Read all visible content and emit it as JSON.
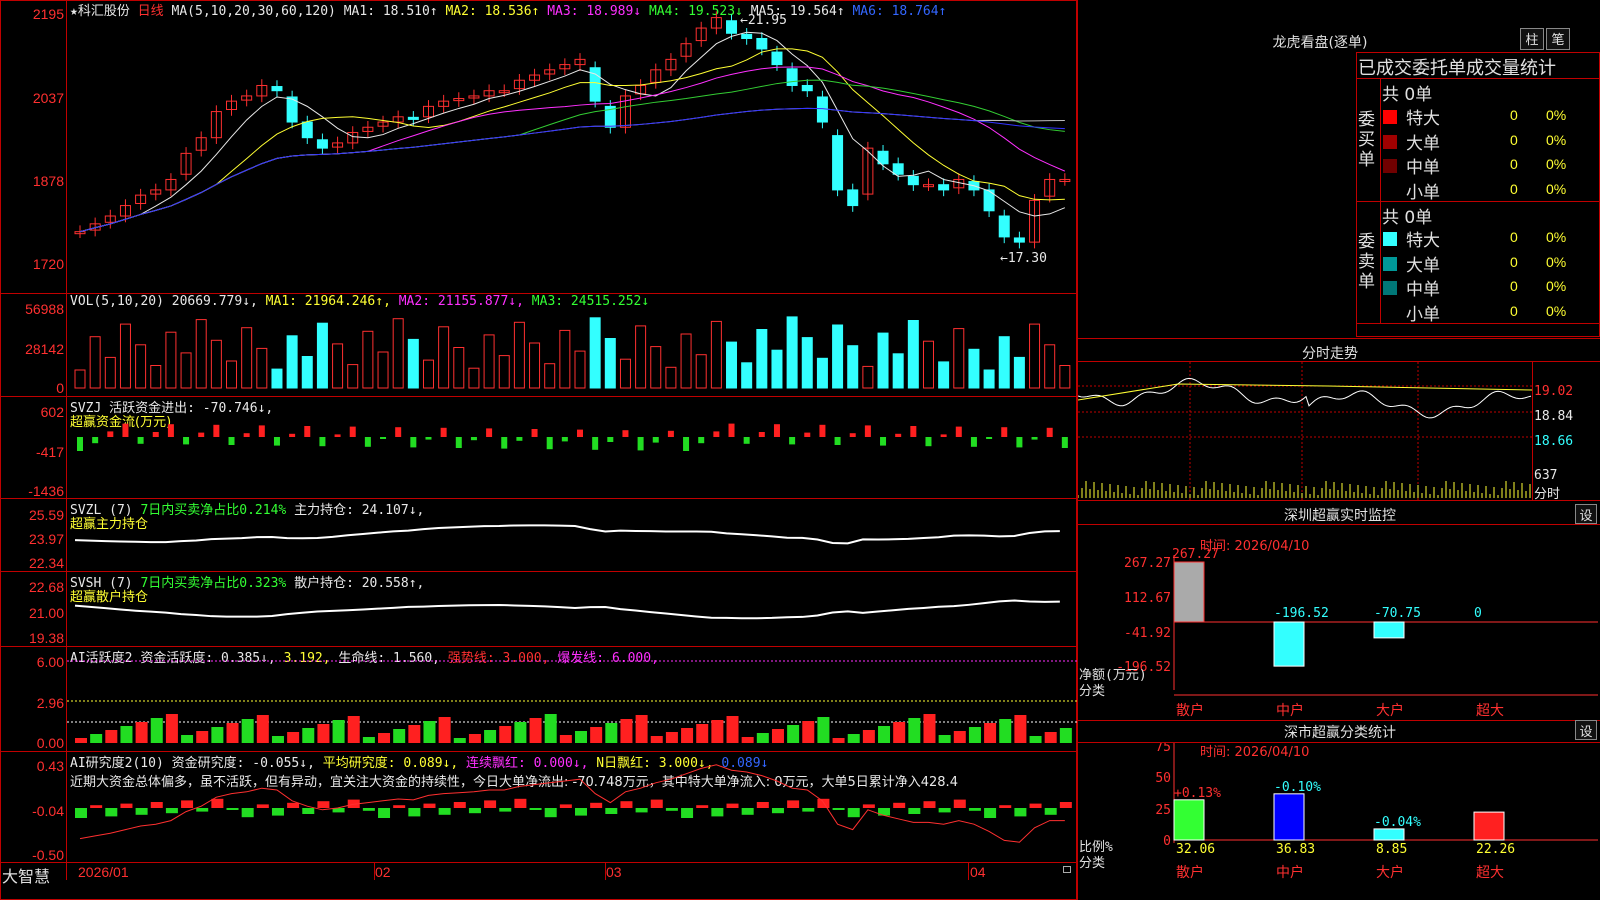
{
  "stock": {
    "star": "★",
    "name": "科汇股份",
    "period": "日线",
    "ma_label": "MA(5,10,20,30,60,120)",
    "ma": [
      {
        "l": "MA1: 18.510↑",
        "c": "w"
      },
      {
        "l": "MA2: 18.536↑",
        "c": "y"
      },
      {
        "l": "MA3: 18.989↓",
        "c": "m"
      },
      {
        "l": "MA4: 19.523↓",
        "c": "g"
      },
      {
        "l": "MA5: 19.564↑",
        "c": "w"
      },
      {
        "l": "MA6: 18.764↑",
        "c": "b"
      }
    ],
    "high_mark": "21.95",
    "low_mark": "17.30",
    "y_labels": [
      "2195",
      "2037",
      "1878",
      "1720"
    ]
  },
  "vol": {
    "header": "VOL(5,10,20)",
    "v": "20669.779↓,",
    "ma1": "MA1: 21964.246↑,",
    "ma2": "MA2: 21155.877↓,",
    "ma3": "MA3: 24515.252↓",
    "y_labels": [
      "56988",
      "28142",
      "0"
    ]
  },
  "svzj": {
    "header": "SVZJ  活跃资金进出: -70.746↓,",
    "sub": "超赢资金流(万元)",
    "y_labels": [
      "602",
      "-417",
      "-1436"
    ]
  },
  "svzl": {
    "header1": "SVZL (7)",
    "header2": "7日内买卖净占比0.214%",
    "header3": "主力持仓: 24.107↓,",
    "sub": "超赢主力持仓",
    "y_labels": [
      "25.59",
      "23.97",
      "22.34"
    ]
  },
  "svsh": {
    "header1": "SVSH (7)",
    "header2": "7日内买卖净占比0.323%",
    "header3": "散户持仓: 20.558↑,",
    "sub": "超赢散户持仓",
    "y_labels": [
      "22.68",
      "21.00",
      "19.38"
    ]
  },
  "ai": {
    "h1": "AI活跃度2",
    "h2": "资金活跃度: 0.385↓,",
    "h3": "3.192,",
    "h4": "生命线: 1.560,",
    "h5": "强势线: 3.000,",
    "h6": "爆发线: 6.000,",
    "y_labels": [
      "6.00",
      "2.96",
      "0.00"
    ]
  },
  "research": {
    "h1": "AI研究度2(10)",
    "h2": "资金研究度: -0.055↓,",
    "h3": "平均研究度: 0.089↓,",
    "h4": "连续飘红: 0.000↓,",
    "h5": "N日飘红: 3.000↓,",
    "h6": "0.089↓",
    "text": "近期大资金总体偏多，虽不活跃，但有异动，宜关注大资金的持续性，今日大单净流出: -70.748万元，其中特大单净流入: 0万元，大单5日累计净入428.4",
    "y_labels": [
      "0.43",
      "-0.04",
      "-0.50"
    ]
  },
  "footer": {
    "brand": "大智慧",
    "dates": [
      "2026/01",
      "02",
      "03",
      "04"
    ]
  },
  "lhb": {
    "title": "龙虎看盘(逐单)",
    "btn1": "柱",
    "btn2": "笔",
    "sub": "已成交委托单成交量统计",
    "buy": {
      "side": "委买单",
      "total": "共 0单",
      "rows": [
        {
          "l": "特大",
          "v": "0",
          "p": "0%",
          "c": "#ff0000"
        },
        {
          "l": "大单",
          "v": "0",
          "p": "0%",
          "c": "#a00000"
        },
        {
          "l": "中单",
          "v": "0",
          "p": "0%",
          "c": "#700000"
        },
        {
          "l": "小单",
          "v": "0",
          "p": "0%",
          "c": ""
        }
      ]
    },
    "sell": {
      "side": "委卖单",
      "total": "共 0单",
      "rows": [
        {
          "l": "特大",
          "v": "0",
          "p": "0%",
          "c": "#33ffff"
        },
        {
          "l": "大单",
          "v": "0",
          "p": "0%",
          "c": "#009999"
        },
        {
          "l": "中单",
          "v": "0",
          "p": "0%",
          "c": "#007777"
        },
        {
          "l": "小单",
          "v": "0",
          "p": "0%",
          "c": ""
        }
      ]
    }
  },
  "intraday": {
    "title": "分时走势",
    "labels": [
      "19.02",
      "18.84",
      "18.66"
    ],
    "vol": "637",
    "unit": "分时"
  },
  "monitor": {
    "title": "深圳超赢实时监控",
    "btn": "设",
    "time": "时间: 2026/04/10",
    "ylabels": [
      "267.27",
      "112.67",
      "-41.92",
      "-196.52"
    ],
    "yunit": "净额(万元)",
    "xunit": "分类",
    "cats": [
      "散户",
      "中户",
      "大户",
      "超大"
    ],
    "vals": [
      "267.27",
      "-196.52",
      "-70.75",
      "0"
    ]
  },
  "classify": {
    "title": "深市超赢分类统计",
    "btn": "设",
    "time": "时间: 2026/04/10",
    "ylabels": [
      "75",
      "50",
      "25",
      "0"
    ],
    "yunit": "比例%",
    "xunit": "分类",
    "cats": [
      "散户",
      "中户",
      "大户",
      "超大"
    ],
    "vals": [
      "32.06",
      "36.83",
      "8.85",
      "22.26"
    ],
    "changes": [
      "+0.13%",
      "-0.10%",
      "-0.04%",
      ""
    ]
  }
}
